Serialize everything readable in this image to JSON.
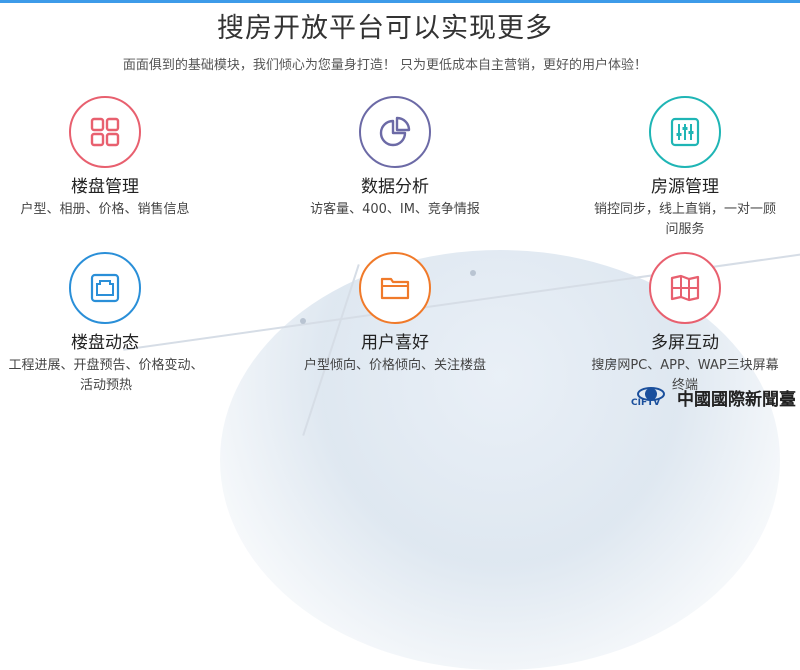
{
  "header": {
    "title": "搜房开放平台可以实现更多",
    "subtitle": "面面俱到的基础模块，我们倾心为您量身打造！ 只为更低成本自主营销，更好的用户体验！"
  },
  "features": [
    {
      "title": "楼盘管理",
      "desc": "户型、相册、价格、销售信息",
      "icon": "grid-icon",
      "color": "#e8606f"
    },
    {
      "title": "数据分析",
      "desc": "访客量、400、IM、竞争情报",
      "icon": "pie-chart-icon",
      "color": "#6c6aa6"
    },
    {
      "title": "房源管理",
      "desc": "销控同步，线上直销，一对一顾问服务",
      "icon": "sliders-icon",
      "color": "#1fb5b5"
    },
    {
      "title": "楼盘动态",
      "desc": "工程进展、开盘预告、价格变动、活动预热",
      "icon": "ethernet-port-icon",
      "color": "#2a8fd8"
    },
    {
      "title": "用户喜好",
      "desc": "户型倾向、价格倾向、关注楼盘",
      "icon": "folder-icon",
      "color": "#f07a2a"
    },
    {
      "title": "多屏互动",
      "desc": "搜房网PC、APP、WAP三块屏幕终端",
      "icon": "map-icon",
      "color": "#e8606f"
    }
  ],
  "watermark": {
    "logo_text": "CIFTV",
    "text": "中國國際新聞臺"
  }
}
